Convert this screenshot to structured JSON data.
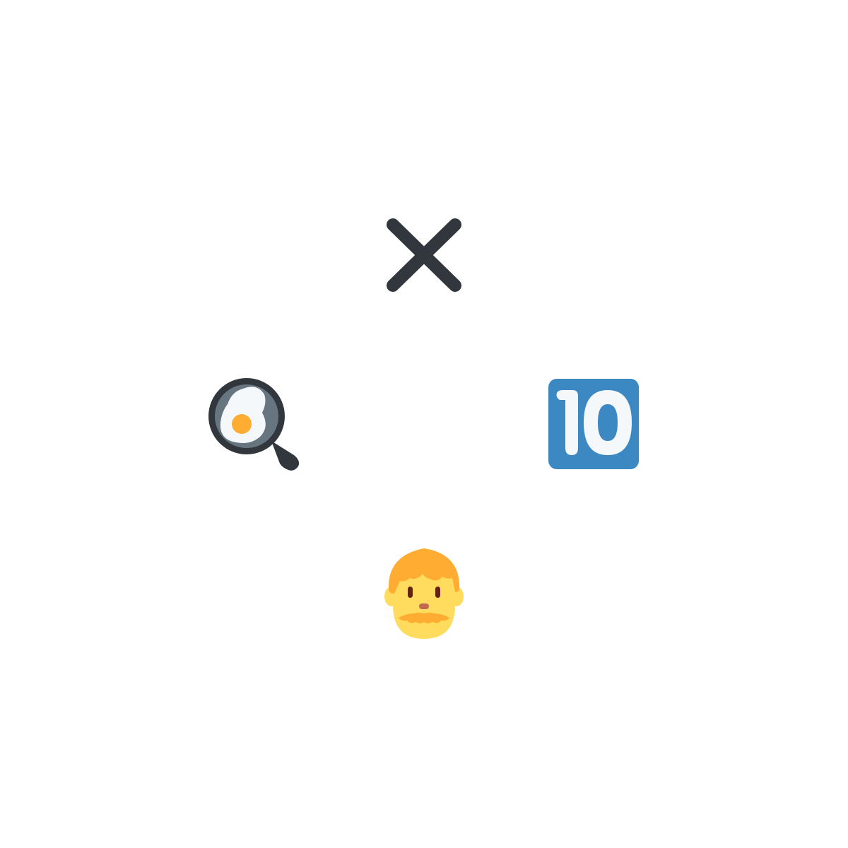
{
  "icons": [
    {
      "name": "multiplication-x-icon",
      "color": "#31373d"
    },
    {
      "name": "frying-pan-egg-icon",
      "colors": {
        "pan": "#31373d",
        "pan_inner": "#66757f",
        "egg_white": "#f5f8fa",
        "yolk": "#ffac33"
      }
    },
    {
      "name": "keycap-ten-icon",
      "label": "10",
      "colors": {
        "background": "#3b88c3",
        "text": "#f5f8fa"
      }
    },
    {
      "name": "man-beard-face-icon",
      "colors": {
        "skin": "#ffdc5d",
        "hair": "#ffac33",
        "eyes": "#662113",
        "nose": "#c1694f"
      }
    }
  ]
}
